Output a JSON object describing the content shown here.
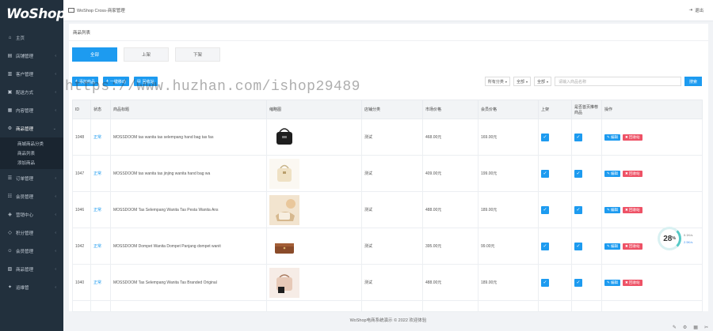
{
  "sidebar": {
    "logo": "WoShop",
    "logo_tag": "商城",
    "items": [
      {
        "label": "主页",
        "icon": "home-icon",
        "glyph": "⌂"
      },
      {
        "label": "店铺管理",
        "icon": "store-icon",
        "glyph": "▤"
      },
      {
        "label": "客户管理",
        "icon": "users-icon",
        "glyph": "▥"
      },
      {
        "label": "配送方式",
        "icon": "truck-icon",
        "glyph": "▣"
      },
      {
        "label": "内容管理",
        "icon": "file-icon",
        "glyph": "▦"
      },
      {
        "label": "商品管理",
        "icon": "gear-icon",
        "glyph": "⚙"
      }
    ],
    "sub_items": [
      "商城商品分类",
      "商品列表",
      "添加商品"
    ],
    "items_after": [
      {
        "label": "订单管理",
        "icon": "order-icon",
        "glyph": "☰"
      },
      {
        "label": "会员管理",
        "icon": "member-icon",
        "glyph": "☷"
      },
      {
        "label": "营销中心",
        "icon": "marketing-icon",
        "glyph": "◈"
      },
      {
        "label": "积分管理",
        "icon": "points-icon",
        "glyph": "◇"
      },
      {
        "label": "会员管理",
        "icon": "member2-icon",
        "glyph": "☺"
      },
      {
        "label": "商品管理",
        "icon": "goods-icon",
        "glyph": "▧"
      },
      {
        "label": "运维管",
        "icon": "ops-icon",
        "glyph": "✦"
      }
    ]
  },
  "topbar": {
    "title": "WoShop Cross-商家管理",
    "exit": "退出"
  },
  "page_title": "商品列表",
  "tabs": [
    "全部",
    "上架",
    "下架"
  ],
  "actions": {
    "add": "添加商品",
    "batch": "一键移动",
    "recycle": "回收站"
  },
  "filters": {
    "category": "所有分类",
    "status1": "全部",
    "status2": "全部",
    "search_placeholder": "请输入商品名称",
    "search_button": "搜索"
  },
  "table": {
    "headers": [
      "ID",
      "状态",
      "商品标题",
      "缩略图",
      "店铺分类",
      "市场价格",
      "会员价格",
      "上架",
      "是否首页推荐商品",
      "操作"
    ],
    "rows": [
      {
        "id": "1048",
        "status": "正常",
        "title": "MOSSDOOM tas wanita tas selempang hand bag tas fas",
        "category": "测试",
        "market": "468.00元",
        "member": "169.00元"
      },
      {
        "id": "1047",
        "status": "正常",
        "title": "MOSSDOOM tas wanita tas jinjing wanita hand bag wa",
        "category": "测试",
        "market": "409.00元",
        "member": "199.00元"
      },
      {
        "id": "1046",
        "status": "正常",
        "title": "MOSSDOOM Tas Selempang Wanita Tas Pesta Wanita Ans",
        "category": "测试",
        "market": "488.00元",
        "member": "189.00元"
      },
      {
        "id": "1042",
        "status": "正常",
        "title": "MOSSDOOM Dompet Wanita Dompet Panjang dompet wanit",
        "category": "测试",
        "market": "395.00元",
        "member": "99.00元"
      },
      {
        "id": "1040",
        "status": "正常",
        "title": "MOSSDOOM Tas Selempang Wanita Tas Branded Original",
        "category": "测试",
        "market": "488.00元",
        "member": "189.00元"
      }
    ],
    "edit_label": "编辑",
    "delete_label": "回收站"
  },
  "watermark": "https://www.huzhan.com/ishop29489",
  "footer": "WoShop电商系统演示 © 2022 欢迎体验",
  "speed": {
    "value": "28",
    "unit": "%",
    "rate_up": "0.1K/s",
    "rate_down": "2.5K/s"
  }
}
